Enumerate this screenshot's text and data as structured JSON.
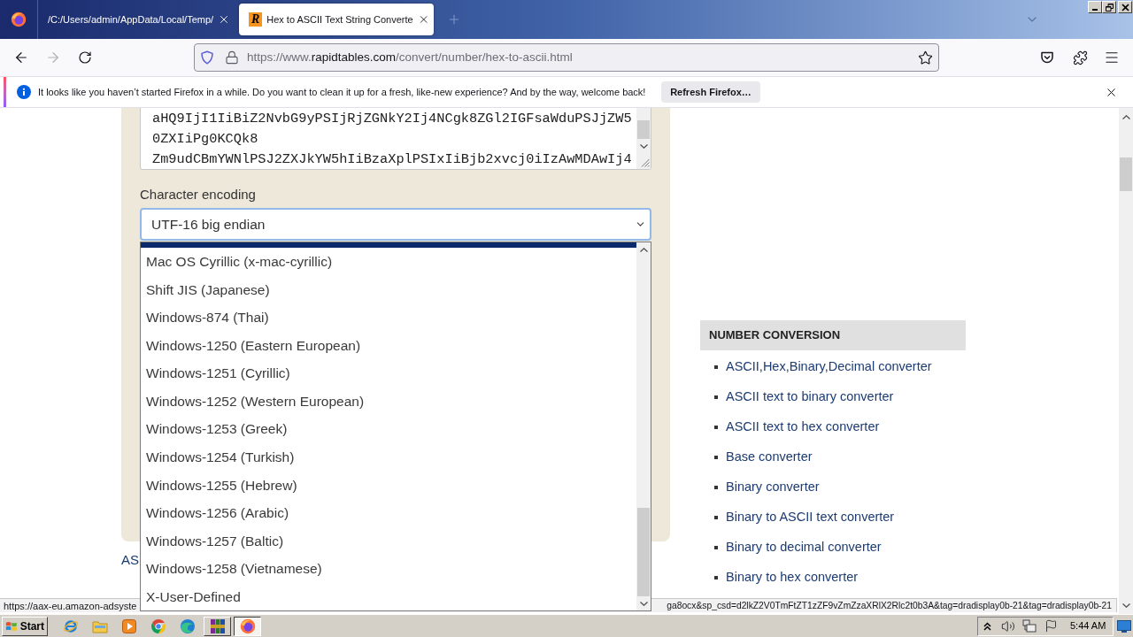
{
  "browser": {
    "tabs": [
      {
        "title": "/C:/Users/admin/AppData/Local/Temp/",
        "selected": false
      },
      {
        "icon_letter": "R",
        "title": "Hex to ASCII Text String Converte",
        "selected": true
      }
    ],
    "nav": {
      "back_disabled": false,
      "forward_disabled": true
    },
    "url": {
      "prefix": "https://www.",
      "domain": "rapidtables.com",
      "path": "/convert/number/hex-to-ascii.html"
    }
  },
  "notification": {
    "message": "It looks like you haven’t started Firefox in a while. Do you want to clean it up for a fresh, like-new experience? And by the way, welcome back!",
    "button": "Refresh Firefox…"
  },
  "converter": {
    "textarea_lines": [
      "aHQ9IjI1IiBiZ2NvbG9yPSIjRjZGNkY2Ij4NCgk8ZGl2IGFsaWduPSJjZW5",
      "0ZXIiPg0KCQk8",
      "Zm9udCBmYWNlPSJ2ZXJkYW5hIiBzaXplPSIxIiBjb2xvcj0iIzAwMDAwIj4"
    ],
    "encoding_label": "Character encoding",
    "encoding_value": "UTF-16 big endian",
    "dropdown_open": true,
    "options": [
      {
        "label": "Mac OS Cyrillic (x-mac-cyrillic)",
        "selected": false
      },
      {
        "label": "Shift JIS (Japanese)",
        "selected": false
      },
      {
        "label": "Windows-874 (Thai)",
        "selected": false
      },
      {
        "label": "Windows-1250 (Eastern European)",
        "selected": false
      },
      {
        "label": "Windows-1251 (Cyrillic)",
        "selected": false
      },
      {
        "label": "Windows-1252 (Western European)",
        "selected": false
      },
      {
        "label": "Windows-1253 (Greek)",
        "selected": false
      },
      {
        "label": "Windows-1254 (Turkish)",
        "selected": false
      },
      {
        "label": "Windows-1255 (Hebrew)",
        "selected": false
      },
      {
        "label": "Windows-1256 (Arabic)",
        "selected": false
      },
      {
        "label": "Windows-1257 (Baltic)",
        "selected": false
      },
      {
        "label": "Windows-1258 (Vietnamese)",
        "selected": false
      },
      {
        "label": "X-User-Defined",
        "selected": false
      }
    ]
  },
  "below_panel_link": "AS",
  "sidebar": {
    "heading": "NUMBER CONVERSION",
    "links": [
      "ASCII,Hex,Binary,Decimal converter",
      "ASCII text to binary converter",
      "ASCII text to hex converter",
      "Base converter",
      "Binary converter",
      "Binary to ASCII text converter",
      "Binary to decimal converter",
      "Binary to hex converter"
    ]
  },
  "status_bar": {
    "left": "https://aax-eu.amazon-adsyste",
    "right": "ga8ocx&sp_csd=d2lkZ2V0TmFtZT1zZF9vZmZzaXRlX2Rlc2t0b3A&tag=dradisplay0b-21&tag=dradisplay0b-21"
  },
  "taskbar": {
    "start": "Start",
    "windows": [
      {
        "kind": "archive",
        "active": false
      },
      {
        "kind": "browser",
        "active": true
      }
    ],
    "clock": "5:44 AM"
  }
}
